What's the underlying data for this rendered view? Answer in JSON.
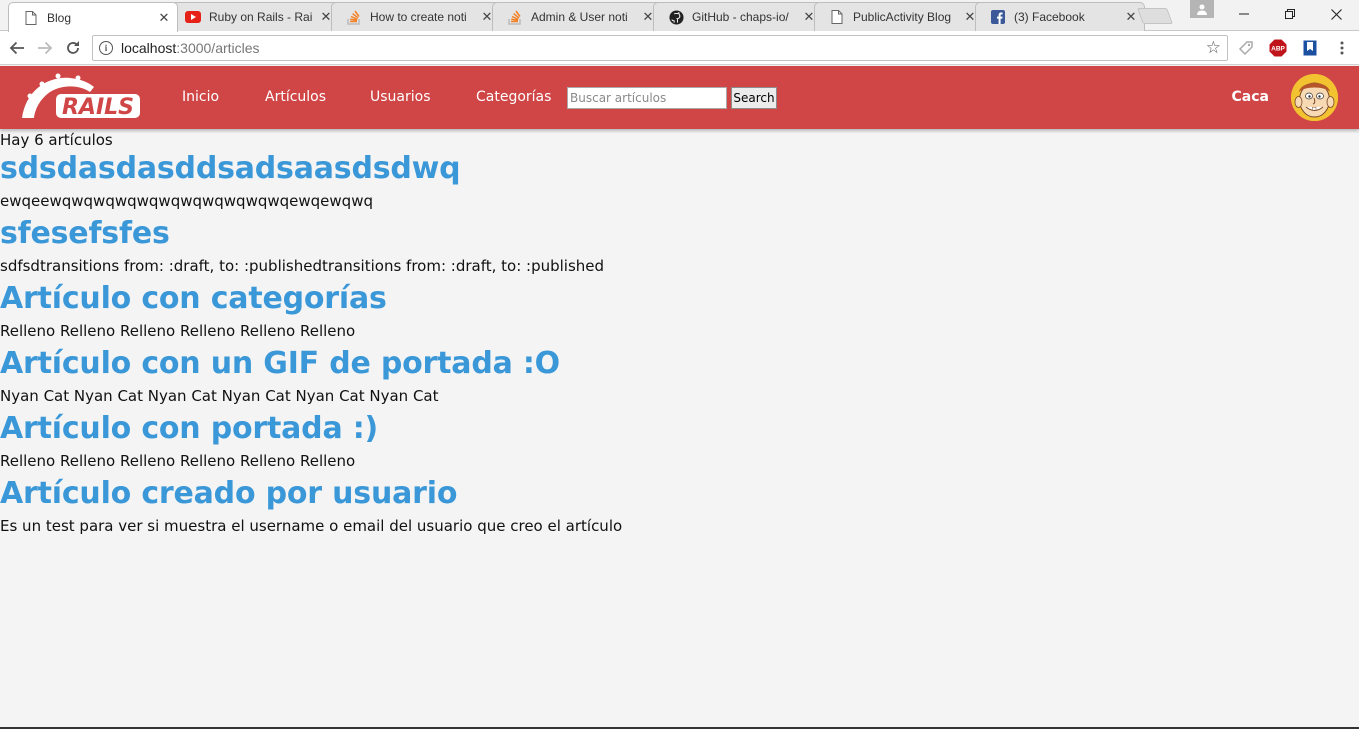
{
  "browser": {
    "tabs": [
      {
        "title": "Blog",
        "icon": "page-icon",
        "active": true
      },
      {
        "title": "Ruby on Rails - Rai",
        "icon": "youtube-icon"
      },
      {
        "title": "How to create noti",
        "icon": "stackoverflow-icon"
      },
      {
        "title": "Admin & User noti",
        "icon": "stackoverflow-icon"
      },
      {
        "title": "GitHub - chaps-io/",
        "icon": "github-icon"
      },
      {
        "title": "PublicActivity Blog",
        "icon": "page-icon"
      },
      {
        "title": "(3) Facebook",
        "icon": "facebook-icon"
      }
    ],
    "url_host": "localhost",
    "url_path": ":3000/articles",
    "adblock_label": "ABP"
  },
  "navbar": {
    "logo_text": "RAILS",
    "links": [
      "Inicio",
      "Artículos",
      "Usuarios",
      "Categorías"
    ],
    "search_placeholder": "Buscar artículos",
    "search_button": "Search",
    "username": "Caca",
    "accent_color": "#d04545"
  },
  "main": {
    "count_text": "Hay 6 artículos",
    "articles": [
      {
        "title": "sdsdasdasddsadsaasdsdwq",
        "body": "ewqeewqwqwqwqwqwqwqwqwqwqwqewqewqwq"
      },
      {
        "title": "sfesefsfes",
        "body": "sdfsdtransitions from: :draft, to: :publishedtransitions from: :draft, to: :published"
      },
      {
        "title": "Artículo con categorías",
        "body": "Relleno Relleno Relleno Relleno Relleno Relleno"
      },
      {
        "title": "Artículo con un GIF de portada :O",
        "body": "Nyan Cat Nyan Cat Nyan Cat Nyan Cat Nyan Cat Nyan Cat"
      },
      {
        "title": "Artículo con portada :)",
        "body": "Relleno Relleno Relleno Relleno Relleno Relleno"
      },
      {
        "title": "Artículo creado por usuario",
        "body": "Es un test para ver si muestra el username o email del usuario que creo el artículo"
      }
    ],
    "title_color": "#3a97d8"
  }
}
